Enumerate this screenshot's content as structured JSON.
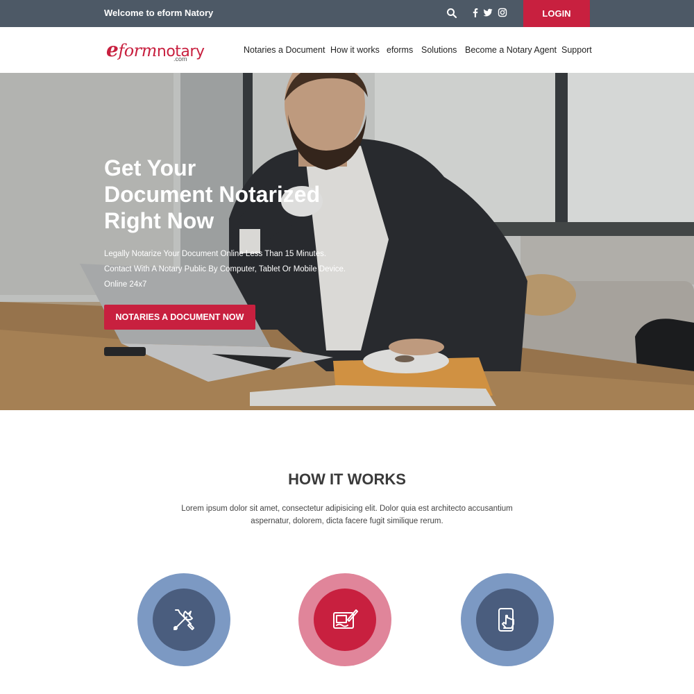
{
  "topbar": {
    "welcome": "Welcome to eform Natory",
    "login_label": "LOGIN"
  },
  "logo": {
    "e": "e",
    "form": "form",
    "notary": "notary",
    "com": ".com"
  },
  "nav": {
    "items": [
      "Notaries a Document",
      "How it works",
      "eforms",
      "Solutions",
      "Become a Notary Agent",
      "Support"
    ]
  },
  "hero": {
    "headline_lines": [
      "Get Your",
      "Document Notarized",
      "Right Now"
    ],
    "subtext_lines": [
      "Legally Notarize Your Document Online Less Than 15 Minutes.",
      "Contact With A Notary Public By Computer, Tablet Or Mobile Device.",
      "Online 24x7"
    ],
    "cta_label": "NOTARIES A DOCUMENT NOW"
  },
  "how_it_works": {
    "title": "HOW IT WORKS",
    "description": "Lorem ipsum dolor sit amet, consectetur adipisicing elit. Dolor quia est architecto accusantium aspernatur, dolorem, dicta facere fugit similique rerum."
  },
  "colors": {
    "brand_red": "#c8203f",
    "topbar": "#4d5966",
    "step_blue_outer": "#7c99c3",
    "step_blue_inner": "#4a5d7e",
    "step_red_outer": "#e0859a"
  },
  "icons": {
    "search": "search-icon",
    "facebook": "facebook-icon",
    "twitter": "twitter-icon",
    "instagram": "instagram-icon",
    "step1": "tools-icon",
    "step2": "tablet-sign-icon",
    "step3": "mobile-touch-icon"
  }
}
